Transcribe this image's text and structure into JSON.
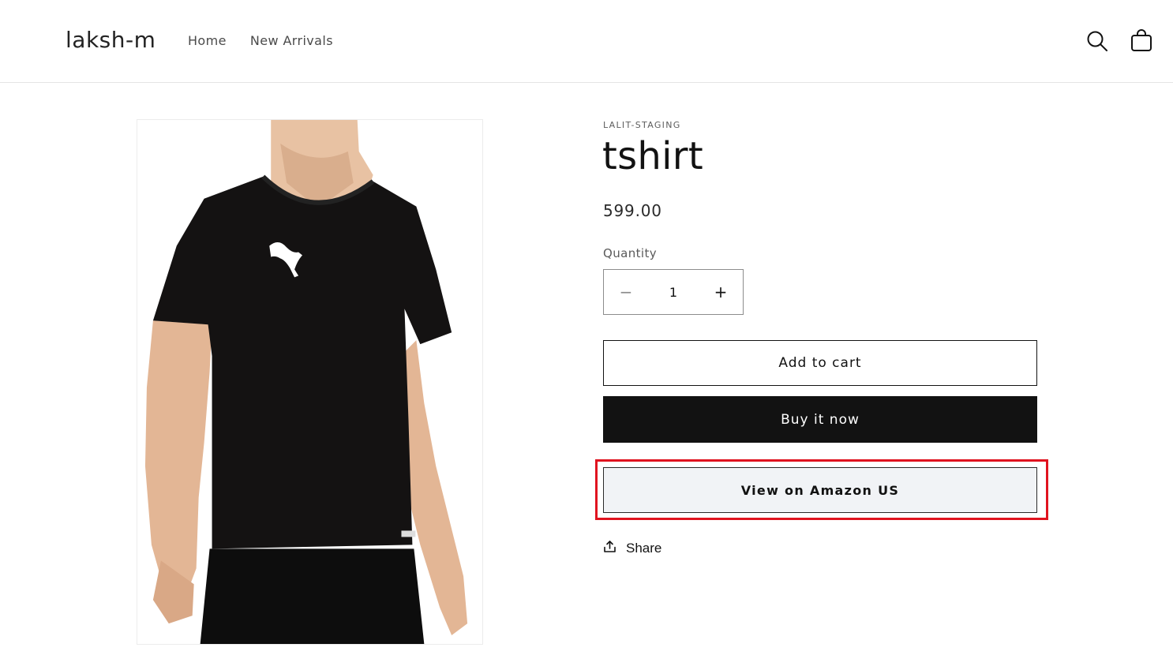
{
  "header": {
    "logo": "laksh-m",
    "nav": [
      {
        "label": "Home"
      },
      {
        "label": "New Arrivals"
      }
    ],
    "icons": {
      "search": "search-icon",
      "cart": "cart-icon"
    }
  },
  "product": {
    "vendor": "LALIT-STAGING",
    "title": "tshirt",
    "price": "599.00",
    "image": {
      "description_icon": "product-image",
      "logo_mark": "puma"
    },
    "quantity": {
      "label": "Quantity",
      "value": "1",
      "minus": "−",
      "plus": "+"
    },
    "buttons": {
      "add_to_cart": "Add to cart",
      "buy_now": "Buy it now",
      "amazon": "View on Amazon US"
    },
    "share": {
      "label": "Share",
      "icon": "share-icon"
    }
  },
  "colors": {
    "text": "#121212",
    "buy_button_bg": "#121212",
    "amazon_button_bg": "#f1f3f6",
    "highlight": "#e0131f"
  }
}
